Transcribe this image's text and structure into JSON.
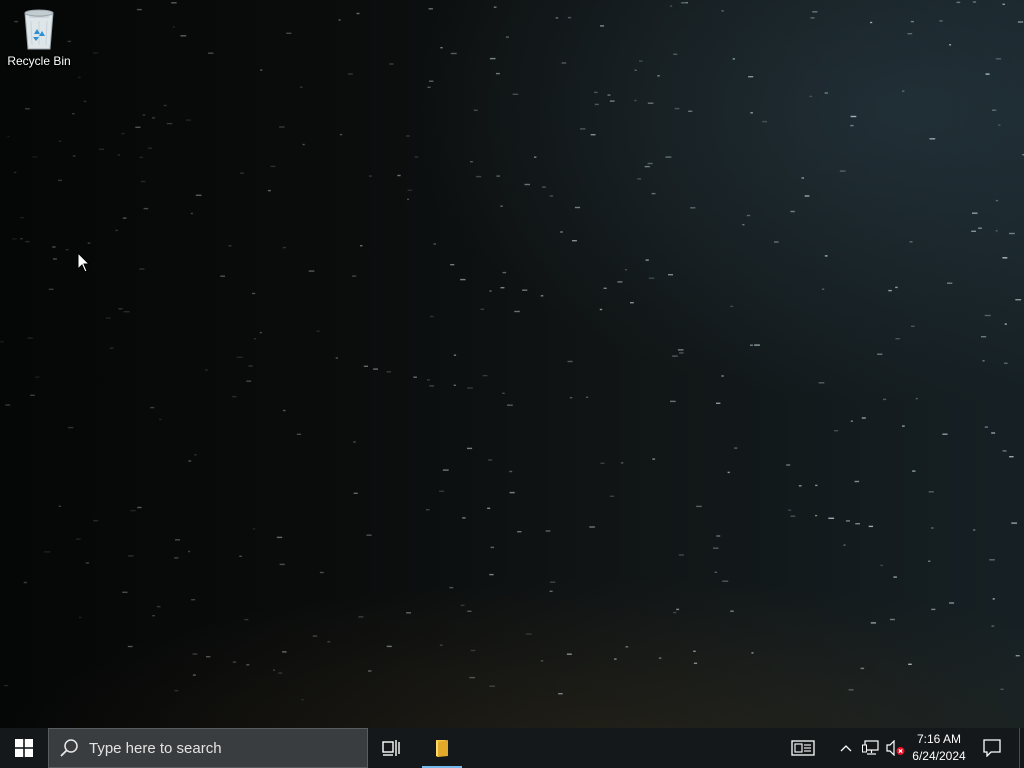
{
  "desktop": {
    "icons": [
      {
        "label": "Recycle Bin",
        "icon": "recycle-bin-icon"
      }
    ]
  },
  "taskbar": {
    "start_icon": "windows-logo-icon",
    "search": {
      "placeholder": "Type here to search",
      "icon": "search-icon"
    },
    "task_view_icon": "task-view-icon",
    "pinned_apps": [
      {
        "name": "File Explorer",
        "icon": "folder-icon",
        "active": true
      }
    ],
    "tray": {
      "news_icon": "news-icon",
      "overflow_icon": "chevron-up-icon",
      "network_icon": "network-icon",
      "volume_icon": "volume-muted-icon",
      "time": "7:16 AM",
      "date": "6/24/2024",
      "notification_icon": "notification-icon"
    }
  },
  "colors": {
    "taskbar_bg": "#14181a",
    "search_bg": "#3a3d3f",
    "active_underline": "#76b9ed",
    "folder_yellow": "#f5c242"
  }
}
